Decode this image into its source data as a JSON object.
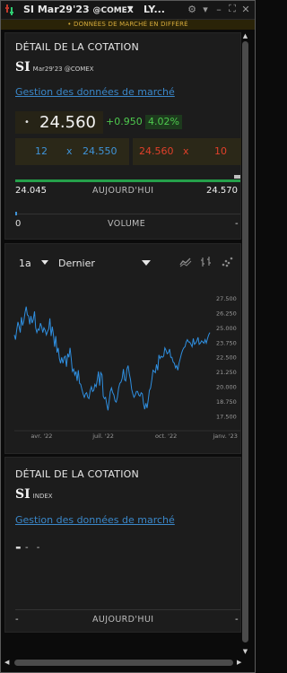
{
  "window": {
    "title": "SI Mar29'23",
    "exchange": "@COMEX",
    "group_label": "LY...",
    "delay_notice": "• DONNÉES DE MARCHÉ EN DIFFÉRÉ",
    "icons": [
      "logo-icon",
      "gear-icon",
      "chevron-down-icon",
      "minimize-icon",
      "maximize-icon",
      "close-icon"
    ]
  },
  "quote_panel": {
    "title": "DÉTAIL DE LA COTATION",
    "symbol": "SI",
    "contract": "Mar29'23 @COMEX",
    "market_data_link": "Gestion des données de marché",
    "bullet": "•",
    "last_price": "24.560",
    "change": "+0.950",
    "change_pct": "4.02%",
    "bid_size": "12",
    "bid_x": "x",
    "bid_price": "24.550",
    "ask_price": "24.560",
    "ask_x": "x",
    "ask_size": "10",
    "day_low": "24.045",
    "day_label": "AUJOURD'HUI",
    "day_high": "24.570",
    "volume_value": "0",
    "volume_label": "VOLUME",
    "volume_dash": "-",
    "colors": {
      "up": "#4ec94e",
      "bid": "#3f93d8",
      "ask": "#e0402a",
      "range": "#25a04a"
    }
  },
  "chart_panel": {
    "period": "1a",
    "field": "Dernier",
    "icons": [
      "line-chart-icon",
      "bar-chart-icon",
      "scatter-chart-icon"
    ]
  },
  "chart_data": {
    "type": "line",
    "series": [
      {
        "values": [
          24.4,
          24.0,
          24.8,
          25.5,
          25.1,
          24.6,
          25.9,
          25.2,
          25.6,
          26.3,
          26.8,
          26.1,
          26.0,
          25.3,
          26.0,
          25.4,
          25.7,
          26.4,
          25.0,
          24.6,
          24.9,
          24.8,
          25.4,
          25.1,
          24.6,
          25.0,
          24.8,
          24.4,
          24.7,
          24.9,
          25.8,
          24.3,
          25.1,
          24.4,
          23.4,
          24.3,
          22.9,
          23.3,
          22.4,
          22.0,
          22.5,
          22.0,
          22.5,
          22.6,
          21.7,
          22.8,
          22.5,
          23.3,
          22.4,
          21.3,
          21.5,
          21.0,
          21.3,
          20.5,
          21.4,
          20.3,
          20.2,
          19.8,
          19.4,
          19.1,
          19.4,
          19.5,
          19.1,
          19.0,
          19.7,
          20.0,
          19.6,
          19.7,
          20.2,
          20.0,
          20.6,
          21.3,
          20.1,
          21.2,
          21.0,
          19.2,
          19.0,
          19.1,
          18.5,
          18.0,
          18.8,
          19.6,
          19.9,
          19.5,
          19.3,
          18.8,
          18.7,
          19.1,
          19.9,
          20.3,
          20.4,
          20.7,
          21.5,
          20.6,
          20.5,
          21.5,
          21.8,
          21.1,
          20.6,
          19.8,
          19.4,
          19.1,
          19.3,
          19.6,
          19.6,
          19.3,
          19.2,
          19.5,
          19.4,
          18.6,
          18.1,
          18.6,
          18.2,
          18.9,
          19.7,
          19.9,
          20.6,
          21.4,
          21.3,
          21.2,
          21.9,
          21.4,
          22.7,
          22.4,
          22.6,
          22.5,
          22.6,
          23.3,
          23.1,
          22.8,
          22.9,
          23.2,
          22.5,
          22.5,
          22.1,
          22.0,
          21.6,
          21.8,
          21.4,
          22.0,
          22.4,
          22.8,
          23.1,
          23.3,
          23.4,
          23.8,
          24.0,
          23.8,
          23.8,
          23.6,
          23.4,
          24.1,
          23.6,
          23.7,
          23.9,
          24.2,
          23.6,
          23.7,
          23.9,
          23.8,
          23.7,
          24.0,
          23.7,
          24.1,
          24.4,
          24.6
        ]
      }
    ],
    "ylim": [
      16.5,
      28.3
    ],
    "yticks": [
      "27.500",
      "26.250",
      "25.000",
      "23.750",
      "22.500",
      "21.250",
      "20.000",
      "18.750",
      "17.500"
    ],
    "ytick_values": [
      27.5,
      26.25,
      25.0,
      23.75,
      22.5,
      21.25,
      20.0,
      18.75,
      17.5
    ],
    "xticks": [
      "avr. '22",
      "juil. '22",
      "oct. '22",
      "janv. '23"
    ],
    "xtick_positions": [
      23,
      75,
      128,
      178
    ],
    "grid": false,
    "line_color": "#2f8fe0"
  },
  "index_panel": {
    "title": "DÉTAIL DE LA COTATION",
    "symbol": "SI",
    "contract": "INDEX",
    "market_data_link": "Gestion des données de marché",
    "last_price": "-",
    "change": "- -",
    "day_low": "-",
    "day_label": "AUJOURD'HUI",
    "day_high": "-"
  }
}
